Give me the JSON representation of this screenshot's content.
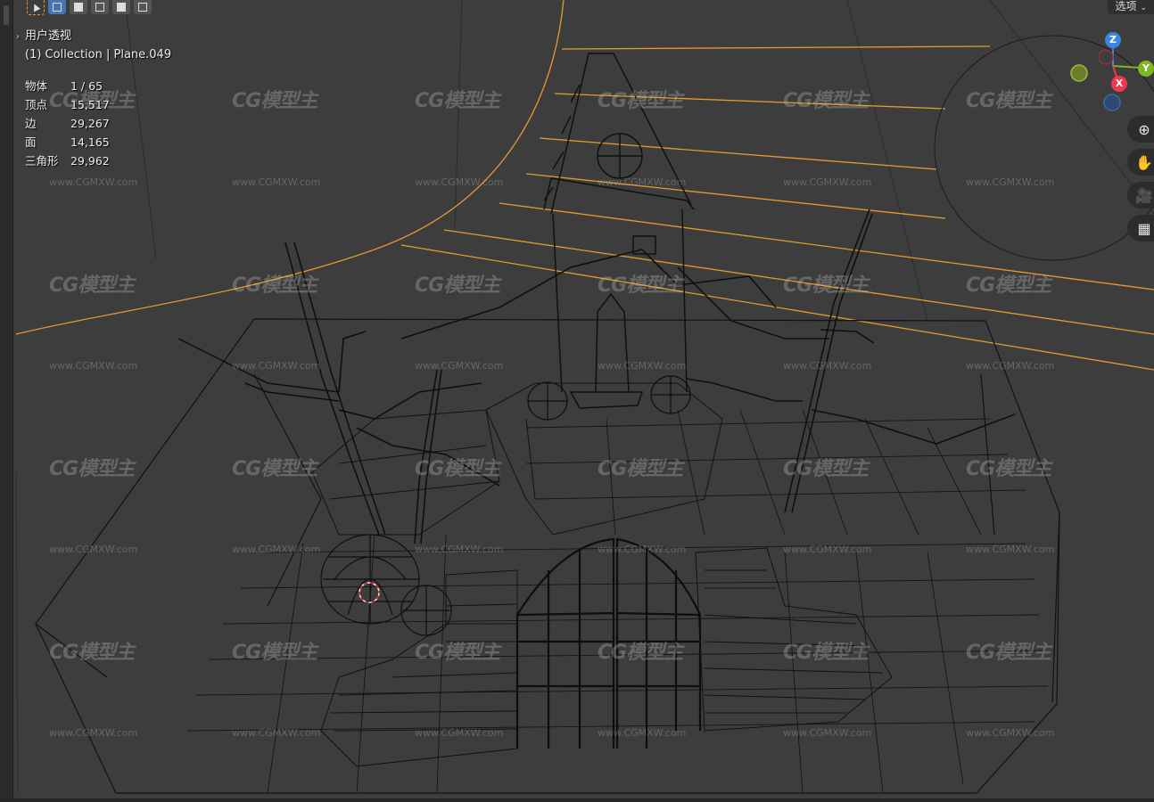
{
  "viewport": {
    "perspective_label": "用户透视",
    "collection_label": "(1) Collection | Plane.049",
    "options_label": "选项"
  },
  "stats": [
    {
      "label": "物体",
      "value": "1 / 65"
    },
    {
      "label": "顶点",
      "value": "15,517"
    },
    {
      "label": "边",
      "value": "29,267"
    },
    {
      "label": "面",
      "value": "14,165"
    },
    {
      "label": "三角形",
      "value": "29,962"
    }
  ],
  "gizmo": {
    "z_label": "Z",
    "x_label": "X",
    "y_label": "Y",
    "colors": {
      "x": "#f0374b",
      "y": "#7db823",
      "z": "#3d86e0"
    }
  },
  "nav_icons": [
    "zoom-icon",
    "pan-hand-icon",
    "camera-icon",
    "perspective-grid-icon"
  ],
  "watermark": {
    "logo": "CG模型主",
    "url": "www.CGMXW.com"
  },
  "colors": {
    "background": "#3d3d3d",
    "wire": "#111111",
    "selected_wire": "#e6992e"
  }
}
